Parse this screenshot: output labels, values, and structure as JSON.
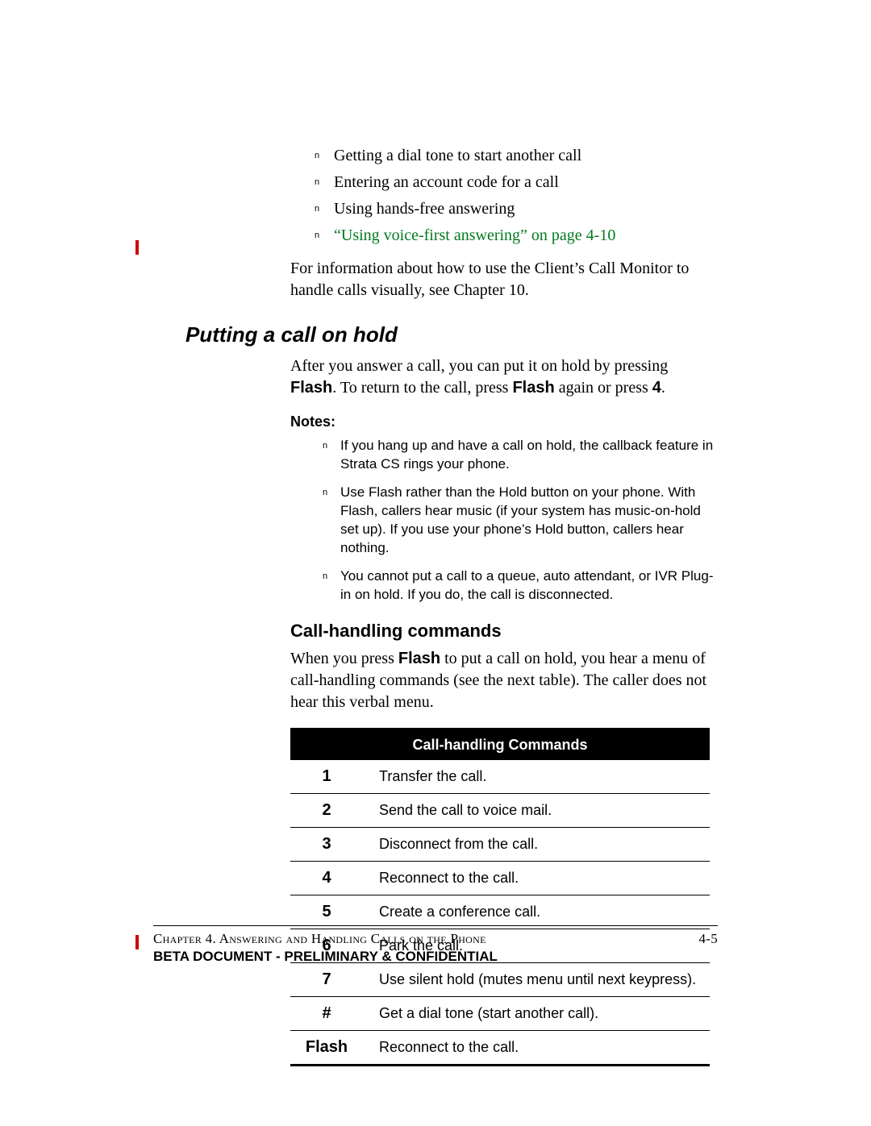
{
  "intro_bullets": [
    {
      "text": "Getting a dial tone to start another call",
      "link": false
    },
    {
      "text": "Entering an account code for a call",
      "link": false
    },
    {
      "text": "Using hands-free answering",
      "link": false
    },
    {
      "text": "“Using voice-first answering” on page 4-10",
      "link": true
    }
  ],
  "intro_para": "For information about how to use the Client’s Call Monitor to handle calls visually, see Chapter 10.",
  "section_heading": "Putting a call on hold",
  "hold_para": {
    "pre1": "After you answer a call, you can put it on hold by pressing ",
    "b1": "Flash",
    "mid": ". To return to the call, press ",
    "b2": "Flash",
    "post": " again or press ",
    "b3": "4",
    "end": "."
  },
  "notes_label": "Notes:",
  "notes": [
    "If you hang up and have a call on hold, the callback feature in Strata CS rings your phone.",
    "Use Flash rather than the Hold button on your phone. With Flash, callers hear music (if your system has music-on-hold set up). If you use your phone’s Hold button, callers hear nothing.",
    "You cannot put a call to a queue, auto attendant, or IVR Plug-in on hold. If you do, the call is disconnected."
  ],
  "subsection_heading": "Call-handling commands",
  "cmds_para": {
    "pre": "When you press ",
    "b1": "Flash",
    "post": " to put a call on hold, you hear a menu of call-handling commands (see the next table). The caller does not hear this verbal menu."
  },
  "table_header": "Call-handling Commands",
  "commands": [
    {
      "key": "1",
      "desc": "Transfer the call."
    },
    {
      "key": "2",
      "desc": "Send the call to voice mail."
    },
    {
      "key": "3",
      "desc": "Disconnect from the call."
    },
    {
      "key": "4",
      "desc": "Reconnect to the call."
    },
    {
      "key": "5",
      "desc": "Create a conference call."
    },
    {
      "key": "6",
      "desc": "Park the call."
    },
    {
      "key": "7",
      "desc": "Use silent hold (mutes menu until next keypress)."
    },
    {
      "key": "#",
      "desc": "Get a dial tone (start another call)."
    },
    {
      "key": "Flash",
      "desc": "Reconnect to the call."
    }
  ],
  "footer": {
    "chapter": "Chapter 4. Answering and Handling Calls on the Phone",
    "page": "4-5",
    "beta": "BETA DOCUMENT - PRELIMINARY & CONFIDENTIAL"
  }
}
